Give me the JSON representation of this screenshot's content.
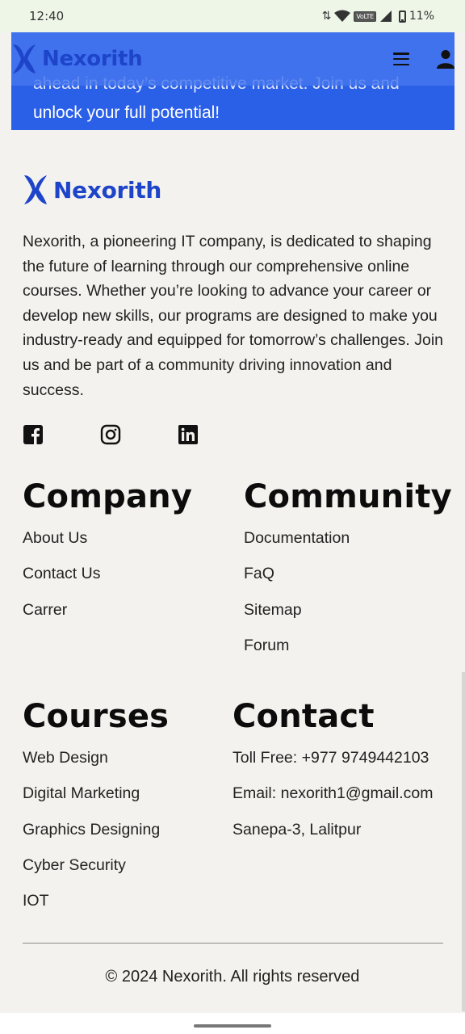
{
  "status_bar": {
    "time": "12:40",
    "network": "VoLTE",
    "battery": "11%"
  },
  "brand": {
    "name": "Nexorith",
    "color": "#1d44c9"
  },
  "hero": {
    "text_cut": "ahead in today’s competitive market. Join us and",
    "text_line": "unlock your full potential!",
    "background": "#2a5fe8"
  },
  "nav": {
    "menu_icon": "hamburger-menu-icon",
    "user_icon": "user-icon"
  },
  "footer": {
    "about": "Nexorith, a pioneering IT company, is dedicated to shaping the future of learning through our comprehensive online courses. Whether you’re looking to advance your career or develop new skills, our programs are designed to make you industry-ready and equipped for tomorrow’s challenges. Join us and be part of a community driving innovation and success.",
    "socials": [
      "facebook-icon",
      "instagram-icon",
      "linkedin-icon"
    ],
    "company": {
      "title": "Company",
      "links": [
        "About Us",
        "Contact Us",
        "Carrer"
      ]
    },
    "community": {
      "title": "Community",
      "links": [
        "Documentation",
        "FaQ",
        "Sitemap",
        "Forum"
      ]
    },
    "courses": {
      "title": "Courses",
      "links": [
        "Web Design",
        "Digital Marketing",
        "Graphics Designing",
        "Cyber Security",
        "IOT"
      ]
    },
    "contact": {
      "title": "Contact",
      "items": [
        "Toll Free: +977 9749442103",
        "Email: nexorith1@gmail.com",
        "Sanepa-3, Lalitpur"
      ]
    },
    "copyright": "© 2024 Nexorith. All rights reserved"
  }
}
